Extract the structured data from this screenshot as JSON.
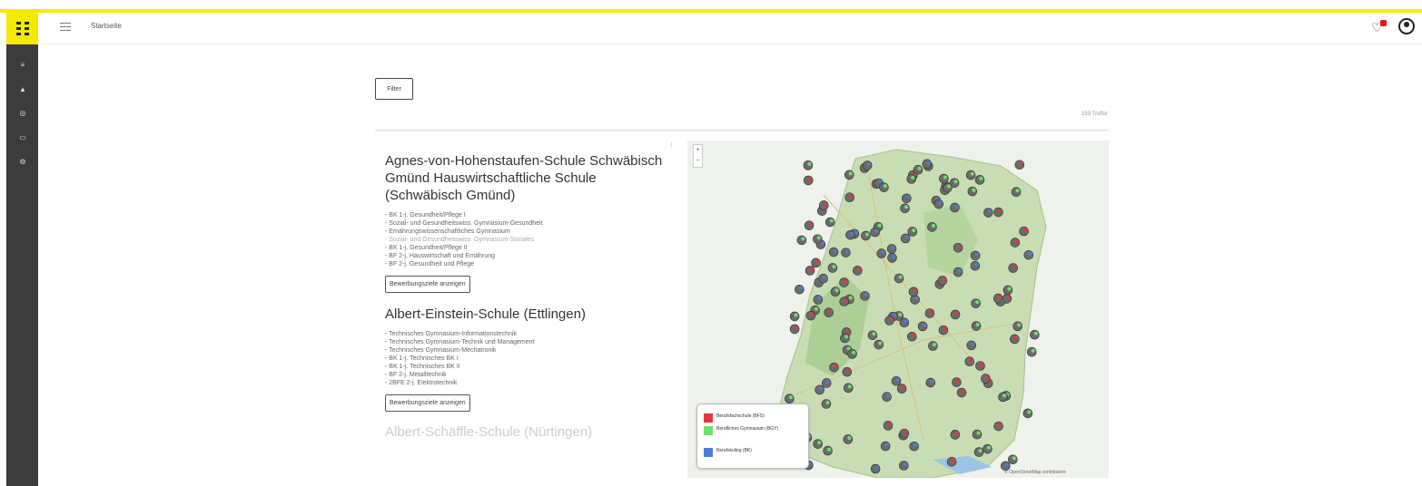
{
  "header": {
    "breadcrumb": "Startseite",
    "notification_badge_color": "#e11111",
    "brand_color": "#f5e900"
  },
  "sidebar": {
    "items": [
      {
        "icon": "list-icon"
      },
      {
        "icon": "inbox-icon"
      },
      {
        "icon": "target-icon"
      },
      {
        "icon": "calendar-icon"
      },
      {
        "icon": "settings-icon"
      }
    ]
  },
  "toolbar": {
    "filter_label": "Filter",
    "hits_label": "153 Treffer"
  },
  "schools": [
    {
      "title": "Agnes-von-Hohenstaufen-Schule Schwäbisch Gmünd Hauswirtschaftliche Schule (Schwäbisch Gmünd)",
      "programs": [
        "- BK 1-j. Gesundheit/Pflege I",
        "- Sozial- und Gesundheitswiss. Gymnasium-Gesundheit",
        "- Ernährungswissenschaftliches Gymnasium",
        "- Sozial- und Gesundheitswiss. Gymnasium-Soziales",
        "- BK 1-j. Gesundheit/Pflege II",
        "- BF 2-j. Hauswirtschaft und Ernährung",
        "- BF 2-j. Gesundheit und Pflege"
      ],
      "button_label": "Bewerbungsziele anzeigen"
    },
    {
      "title": "Albert-Einstein-Schule (Ettlingen)",
      "programs": [
        "- Technisches Gymnasium-Informationstechnik",
        "- Technisches Gymnasium-Technik und Management",
        "- Technisches Gymnasium-Mechatronik",
        "- BK 1-j. Technisches BK I",
        "- BK 1-j. Technisches BK II",
        "- BF 2-j. Metalltechnik",
        "- 2BFE 2-j. Elektrotechnik"
      ],
      "button_label": "Bewerbungsziele anzeigen"
    }
  ],
  "next_school_title": "Albert-Schäffle-Schule (Nürtingen)",
  "map": {
    "zoom_in": "+",
    "zoom_out": "−",
    "attribution": "© OpenStreetMap contributors",
    "legend": [
      {
        "label": "Berufsfachschule (BFS)",
        "color": "#e8363d"
      },
      {
        "label": "Berufliches Gymnasium (BGY)",
        "color": "#6ee06e"
      },
      {
        "label": "Berufskolleg (BK)",
        "color": "#4a7fd8"
      }
    ]
  }
}
